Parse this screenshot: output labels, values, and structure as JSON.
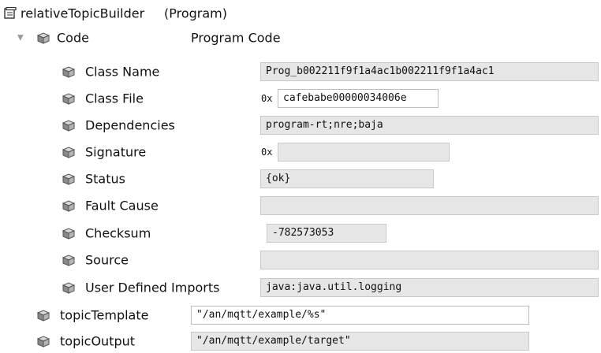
{
  "program": {
    "name": "relativeTopicBuilder",
    "type": "(Program)"
  },
  "code": {
    "label": "Code",
    "description": "Program Code",
    "expanded_glyph": "▼",
    "rows": {
      "class_name": {
        "label": "Class Name",
        "value": "Prog_b002211f9f1a4ac1b002211f9f1a4ac1"
      },
      "class_file": {
        "label": "Class File",
        "prefix": "0x",
        "value": "cafebabe00000034006e"
      },
      "dependencies": {
        "label": "Dependencies",
        "value": "program-rt;nre;baja"
      },
      "signature": {
        "label": "Signature",
        "prefix": "0x",
        "value": ""
      },
      "status": {
        "label": "Status",
        "value": "{ok}"
      },
      "fault_cause": {
        "label": "Fault Cause",
        "value": ""
      },
      "checksum": {
        "label": "Checksum",
        "value": "-782573053"
      },
      "source": {
        "label": "Source",
        "value": ""
      },
      "user_defined_imports": {
        "label": "User Defined Imports",
        "value": "java:java.util.logging"
      }
    }
  },
  "topic_template": {
    "label": "topicTemplate",
    "value": "\"/an/mqtt/example/%s\""
  },
  "topic_output": {
    "label": "topicOutput",
    "value": "\"/an/mqtt/example/target\""
  },
  "icons": {
    "program": "program-icon",
    "component": "slot-cube-icon"
  },
  "colors": {
    "field_readonly": "#e6e6e6",
    "field_border": "#c9c9c9",
    "text": "#111111"
  }
}
